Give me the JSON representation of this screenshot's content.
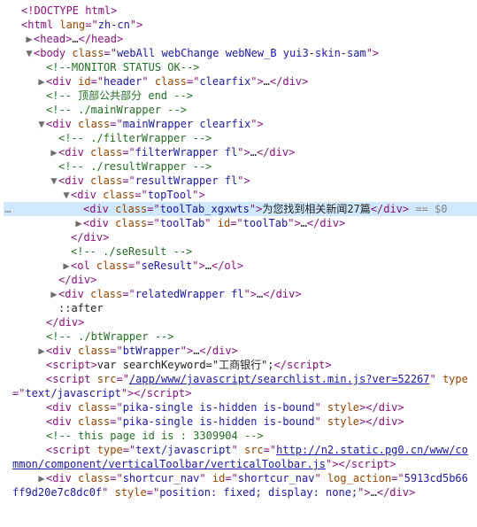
{
  "lines": [
    {
      "indent": 0,
      "arrow": "",
      "gutter": "",
      "hl": false,
      "segs": [
        [
          "p",
          "<!DOCTYPE html>"
        ]
      ]
    },
    {
      "indent": 0,
      "arrow": "",
      "gutter": "",
      "hl": false,
      "segs": [
        [
          "p",
          "<html "
        ],
        [
          "a",
          "lang"
        ],
        [
          "p",
          "=\""
        ],
        [
          "v",
          "zh-cn"
        ],
        [
          "p",
          "\">"
        ]
      ]
    },
    {
      "indent": 1,
      "arrow": "▶",
      "gutter": "",
      "hl": false,
      "segs": [
        [
          "p",
          "<head>"
        ],
        [
          "t",
          "…"
        ],
        [
          "p",
          "</head>"
        ]
      ]
    },
    {
      "indent": 1,
      "arrow": "▼",
      "gutter": "",
      "hl": false,
      "segs": [
        [
          "p",
          "<body "
        ],
        [
          "a",
          "class"
        ],
        [
          "p",
          "=\""
        ],
        [
          "v",
          "webAll webChange webNew_B yui3-skin-sam"
        ],
        [
          "p",
          "\">"
        ]
      ]
    },
    {
      "indent": 2,
      "arrow": "",
      "gutter": "",
      "hl": false,
      "segs": [
        [
          "c",
          "<!--MONITOR STATUS OK-->"
        ]
      ]
    },
    {
      "indent": 2,
      "arrow": "▶",
      "gutter": "",
      "hl": false,
      "segs": [
        [
          "p",
          "<div "
        ],
        [
          "a",
          "id"
        ],
        [
          "p",
          "=\""
        ],
        [
          "v",
          "header"
        ],
        [
          "p",
          "\" "
        ],
        [
          "a",
          "class"
        ],
        [
          "p",
          "=\""
        ],
        [
          "v",
          "clearfix"
        ],
        [
          "p",
          "\">"
        ],
        [
          "t",
          "…"
        ],
        [
          "p",
          "</div>"
        ]
      ]
    },
    {
      "indent": 2,
      "arrow": "",
      "gutter": "",
      "hl": false,
      "segs": [
        [
          "c",
          "<!-- 顶部公共部分 end -->"
        ]
      ]
    },
    {
      "indent": 2,
      "arrow": "",
      "gutter": "",
      "hl": false,
      "segs": [
        [
          "c",
          "<!-- ./mainWrapper -->"
        ]
      ]
    },
    {
      "indent": 2,
      "arrow": "▼",
      "gutter": "",
      "hl": false,
      "segs": [
        [
          "p",
          "<div "
        ],
        [
          "a",
          "class"
        ],
        [
          "p",
          "=\""
        ],
        [
          "v",
          "mainWrapper clearfix"
        ],
        [
          "p",
          "\">"
        ]
      ]
    },
    {
      "indent": 3,
      "arrow": "",
      "gutter": "",
      "hl": false,
      "segs": [
        [
          "c",
          "<!-- ./filterWrapper -->"
        ]
      ]
    },
    {
      "indent": 3,
      "arrow": "▶",
      "gutter": "",
      "hl": false,
      "segs": [
        [
          "p",
          "<div "
        ],
        [
          "a",
          "class"
        ],
        [
          "p",
          "=\""
        ],
        [
          "v",
          "filterWrapper fl"
        ],
        [
          "p",
          "\">"
        ],
        [
          "t",
          "…"
        ],
        [
          "p",
          "</div>"
        ]
      ]
    },
    {
      "indent": 3,
      "arrow": "",
      "gutter": "",
      "hl": false,
      "segs": [
        [
          "c",
          "<!-- ./resultWrapper -->"
        ]
      ]
    },
    {
      "indent": 3,
      "arrow": "▼",
      "gutter": "",
      "hl": false,
      "segs": [
        [
          "p",
          "<div "
        ],
        [
          "a",
          "class"
        ],
        [
          "p",
          "=\""
        ],
        [
          "v",
          "resultWrapper fl"
        ],
        [
          "p",
          "\">"
        ]
      ]
    },
    {
      "indent": 4,
      "arrow": "▼",
      "gutter": "",
      "hl": false,
      "segs": [
        [
          "p",
          "<div "
        ],
        [
          "a",
          "class"
        ],
        [
          "p",
          "=\""
        ],
        [
          "v",
          "topTool"
        ],
        [
          "p",
          "\">"
        ]
      ]
    },
    {
      "indent": 5,
      "arrow": "",
      "gutter": "…",
      "hl": true,
      "segs": [
        [
          "p",
          "<div "
        ],
        [
          "a",
          "class"
        ],
        [
          "p",
          "=\""
        ],
        [
          "v",
          "toolTab_xgxwts"
        ],
        [
          "p",
          "\">"
        ],
        [
          "t",
          "为您找到相关新闻27篇"
        ],
        [
          "p",
          "</div>"
        ],
        [
          "sel",
          " == $0"
        ]
      ]
    },
    {
      "indent": 5,
      "arrow": "▶",
      "gutter": "",
      "hl": false,
      "segs": [
        [
          "p",
          "<div "
        ],
        [
          "a",
          "class"
        ],
        [
          "p",
          "=\""
        ],
        [
          "v",
          "toolTab"
        ],
        [
          "p",
          "\" "
        ],
        [
          "a",
          "id"
        ],
        [
          "p",
          "=\""
        ],
        [
          "v",
          "toolTab"
        ],
        [
          "p",
          "\">"
        ],
        [
          "t",
          "…"
        ],
        [
          "p",
          "</div>"
        ]
      ]
    },
    {
      "indent": 4,
      "arrow": "",
      "gutter": "",
      "hl": false,
      "segs": [
        [
          "p",
          "</div>"
        ]
      ]
    },
    {
      "indent": 4,
      "arrow": "",
      "gutter": "",
      "hl": false,
      "segs": [
        [
          "c",
          "<!-- ./seResult -->"
        ]
      ]
    },
    {
      "indent": 4,
      "arrow": "▶",
      "gutter": "",
      "hl": false,
      "segs": [
        [
          "p",
          "<ol "
        ],
        [
          "a",
          "class"
        ],
        [
          "p",
          "=\""
        ],
        [
          "v",
          "seResult"
        ],
        [
          "p",
          "\">"
        ],
        [
          "t",
          "…"
        ],
        [
          "p",
          "</ol>"
        ]
      ]
    },
    {
      "indent": 3,
      "arrow": "",
      "gutter": "",
      "hl": false,
      "segs": [
        [
          "p",
          "</div>"
        ]
      ]
    },
    {
      "indent": 3,
      "arrow": "▶",
      "gutter": "",
      "hl": false,
      "segs": [
        [
          "p",
          "<div "
        ],
        [
          "a",
          "class"
        ],
        [
          "p",
          "=\""
        ],
        [
          "v",
          "relatedWrapper fl"
        ],
        [
          "p",
          "\">"
        ],
        [
          "t",
          "…"
        ],
        [
          "p",
          "</div>"
        ]
      ]
    },
    {
      "indent": 3,
      "arrow": "",
      "gutter": "",
      "hl": false,
      "segs": [
        [
          "t",
          "::after"
        ]
      ]
    },
    {
      "indent": 2,
      "arrow": "",
      "gutter": "",
      "hl": false,
      "segs": [
        [
          "p",
          "</div>"
        ]
      ]
    },
    {
      "indent": 2,
      "arrow": "",
      "gutter": "",
      "hl": false,
      "segs": [
        [
          "c",
          "<!-- ./btWrapper -->"
        ]
      ]
    },
    {
      "indent": 2,
      "arrow": "▶",
      "gutter": "",
      "hl": false,
      "segs": [
        [
          "p",
          "<div "
        ],
        [
          "a",
          "class"
        ],
        [
          "p",
          "=\""
        ],
        [
          "v",
          "btWrapper"
        ],
        [
          "p",
          "\">"
        ],
        [
          "t",
          "…"
        ],
        [
          "p",
          "</div>"
        ]
      ]
    },
    {
      "indent": 2,
      "arrow": "",
      "gutter": "",
      "hl": false,
      "segs": [
        [
          "p",
          "<script>"
        ],
        [
          "t",
          "var searchKeyword=\"工商银行\";"
        ],
        [
          "p",
          "</script>"
        ]
      ]
    },
    {
      "indent": 2,
      "arrow": "",
      "gutter": "",
      "hl": false,
      "segs": [
        [
          "p",
          "<script "
        ],
        [
          "a",
          "src"
        ],
        [
          "p",
          "=\""
        ],
        [
          "lnk",
          "/app/www/javascript/searchlist.min.js?ver=52267"
        ],
        [
          "p",
          "\" "
        ],
        [
          "a",
          "type"
        ],
        [
          "p",
          "=\""
        ],
        [
          "v",
          "text/javascript"
        ],
        [
          "p",
          "\">"
        ],
        [
          "p",
          "</script>"
        ]
      ]
    },
    {
      "indent": 2,
      "arrow": "",
      "gutter": "",
      "hl": false,
      "segs": [
        [
          "p",
          "<div "
        ],
        [
          "a",
          "class"
        ],
        [
          "p",
          "=\""
        ],
        [
          "v",
          "pika-single is-hidden is-bound"
        ],
        [
          "p",
          "\" "
        ],
        [
          "a",
          "style"
        ],
        [
          "p",
          ">"
        ],
        [
          "p",
          "</div>"
        ]
      ]
    },
    {
      "indent": 2,
      "arrow": "",
      "gutter": "",
      "hl": false,
      "segs": [
        [
          "p",
          "<div "
        ],
        [
          "a",
          "class"
        ],
        [
          "p",
          "=\""
        ],
        [
          "v",
          "pika-single is-hidden is-bound"
        ],
        [
          "p",
          "\" "
        ],
        [
          "a",
          "style"
        ],
        [
          "p",
          ">"
        ],
        [
          "p",
          "</div>"
        ]
      ]
    },
    {
      "indent": 2,
      "arrow": "",
      "gutter": "",
      "hl": false,
      "segs": [
        [
          "c",
          "<!-- this page id is : 3309904 -->"
        ]
      ]
    },
    {
      "indent": 2,
      "arrow": "",
      "gutter": "",
      "hl": false,
      "segs": [
        [
          "p",
          "<script "
        ],
        [
          "a",
          "type"
        ],
        [
          "p",
          "=\""
        ],
        [
          "v",
          "text/javascript"
        ],
        [
          "p",
          "\" "
        ],
        [
          "a",
          "src"
        ],
        [
          "p",
          "=\""
        ],
        [
          "lnk",
          "http://n2.static.pg0.cn/www/common/component/verticalToolbar/verticalToolbar.js"
        ],
        [
          "p",
          "\">"
        ],
        [
          "p",
          "</script>"
        ]
      ]
    },
    {
      "indent": 2,
      "arrow": "▶",
      "gutter": "",
      "hl": false,
      "segs": [
        [
          "p",
          "<div "
        ],
        [
          "a",
          "class"
        ],
        [
          "p",
          "=\""
        ],
        [
          "v",
          "shortcur_nav"
        ],
        [
          "p",
          "\" "
        ],
        [
          "a",
          "id"
        ],
        [
          "p",
          "=\""
        ],
        [
          "v",
          "shortcur_nav"
        ],
        [
          "p",
          "\" "
        ],
        [
          "a",
          "log_action"
        ],
        [
          "p",
          "=\""
        ],
        [
          "v",
          "5913cd5b66ff9d20e7c8dc0f"
        ],
        [
          "p",
          "\" "
        ],
        [
          "a",
          "style"
        ],
        [
          "p",
          "=\""
        ],
        [
          "v",
          "position: fixed; display: none;"
        ],
        [
          "p",
          "\">"
        ],
        [
          "t",
          "…"
        ],
        [
          "p",
          "</div>"
        ]
      ]
    }
  ],
  "indent_unit": 14
}
